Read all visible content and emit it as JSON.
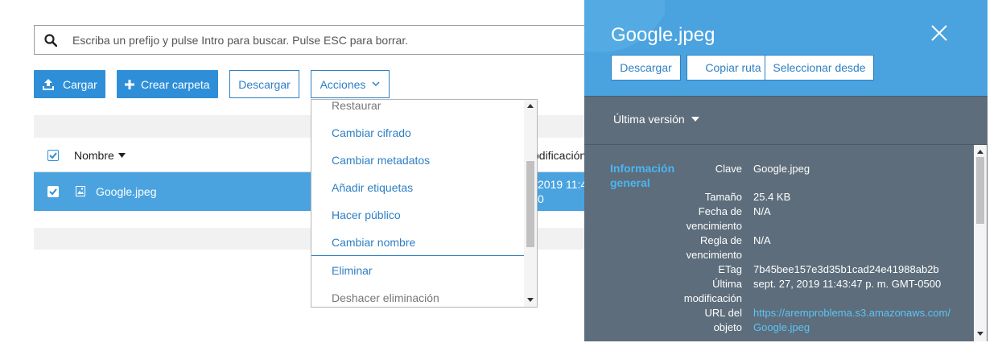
{
  "search": {
    "placeholder": "Escriba un prefijo y pulse Intro para buscar. Pulse ESC para borrar."
  },
  "toolbar": {
    "upload_label": "Cargar",
    "create_folder_label": "Crear carpeta",
    "download_label": "Descargar",
    "actions_label": "Acciones"
  },
  "table": {
    "header": {
      "name": "Nombre",
      "modified_partial": "odificación"
    },
    "rows": [
      {
        "name": "Google.jpeg",
        "modified_partial": "2019 11:4",
        "modified_partial2": "0"
      }
    ]
  },
  "actions_menu": {
    "items": [
      {
        "label": "Restaurar"
      },
      {
        "label": "Cambiar cifrado"
      },
      {
        "label": "Cambiar metadatos"
      },
      {
        "label": "Añadir etiquetas"
      },
      {
        "label": "Hacer público"
      },
      {
        "label": "Cambiar nombre"
      },
      {
        "label": "Eliminar"
      },
      {
        "label": "Deshacer eliminación"
      }
    ]
  },
  "panel": {
    "title": "Google.jpeg",
    "buttons": {
      "download": "Descargar",
      "copy_path": "Copiar ruta",
      "select_from": "Seleccionar desde"
    },
    "version_label": "Última versión",
    "section_title_1": "Información",
    "section_title_2": "general",
    "fields": {
      "key_label": "Clave",
      "key_value": "Google.jpeg",
      "size_label": "Tamaño",
      "size_value": "25.4 KB",
      "expiry_label_1": "Fecha de",
      "expiry_label_2": "vencimiento",
      "expiry_value": "N/A",
      "rule_label_1": "Regla de",
      "rule_label_2": "vencimiento",
      "rule_value": "N/A",
      "etag_label": "ETag",
      "etag_value": "7b45bee157e3d35b1cad24e41988ab2b",
      "modified_label_1": "Última",
      "modified_label_2": "modificación",
      "modified_value": "sept. 27, 2019 11:43:47 p. m. GMT-0500",
      "url_label_1": "URL del",
      "url_label_2": "objeto",
      "url_value_1": "https://aremproblema.s3.amazonaws.com/",
      "url_value_2": "Google.jpeg"
    }
  },
  "colors": {
    "primary": "#2e8fd8",
    "panel_header": "#4aa3df",
    "panel_body": "#5d6d7b",
    "selected_row": "#4aa3df"
  }
}
